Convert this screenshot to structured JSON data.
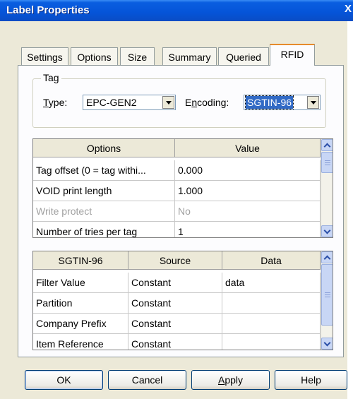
{
  "window": {
    "title": "Label Properties",
    "close_glyph": "X"
  },
  "tabs": [
    {
      "label": "Settings",
      "active": false
    },
    {
      "label": "Options",
      "active": false
    },
    {
      "label": "Size",
      "active": false
    },
    {
      "label": "Summary",
      "active": false
    },
    {
      "label": "Queried",
      "active": false
    },
    {
      "label": "RFID",
      "active": true
    }
  ],
  "tag_group": {
    "legend": "Tag",
    "type_label_prefix": "T",
    "type_label_rest": "ype:",
    "type_value": "EPC-GEN2",
    "encoding_label_prefix": "E",
    "encoding_label_mnemonic": "n",
    "encoding_label_rest": "coding:",
    "encoding_value": "SGTIN-96"
  },
  "options_grid": {
    "headers": [
      "Options",
      "Value"
    ],
    "rows": [
      {
        "option": "Tag offset (0 = tag withi...",
        "value": "0.000",
        "disabled": false
      },
      {
        "option": "VOID print length",
        "value": "1.000",
        "disabled": false
      },
      {
        "option": "Write protect",
        "value": "No",
        "disabled": true
      },
      {
        "option": "Number of tries per tag",
        "value": "1",
        "disabled": false
      }
    ]
  },
  "sgtin_grid": {
    "headers": [
      "SGTIN-96",
      "Source",
      "Data"
    ],
    "rows": [
      {
        "field": "Filter Value",
        "source": "Constant",
        "data": "data"
      },
      {
        "field": "Partition",
        "source": "Constant",
        "data": ""
      },
      {
        "field": "Company Prefix",
        "source": "Constant",
        "data": ""
      },
      {
        "field": "Item Reference",
        "source": "Constant",
        "data": ""
      }
    ]
  },
  "buttons": {
    "ok": "OK",
    "cancel": "Cancel",
    "apply_mnemonic": "A",
    "apply_rest": "pply",
    "help": "Help"
  }
}
